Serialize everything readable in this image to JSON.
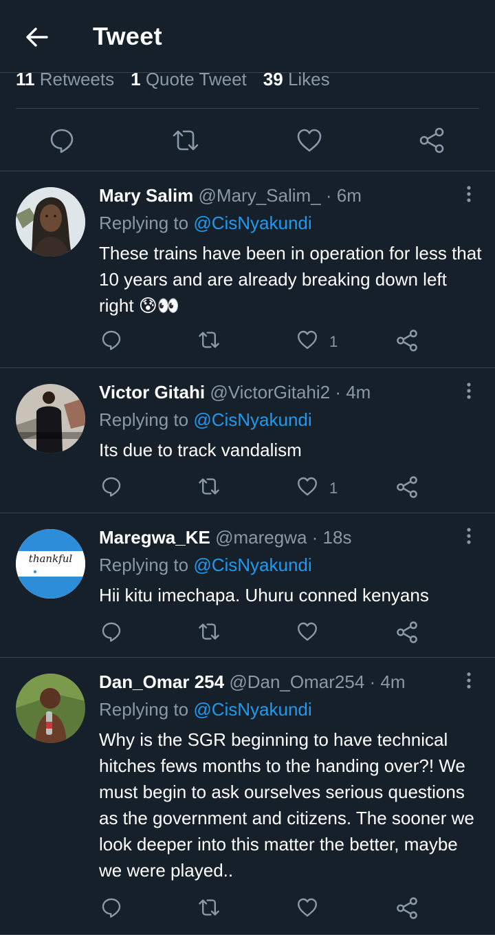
{
  "header": {
    "title": "Tweet"
  },
  "stats": {
    "retweets_count": "11",
    "retweets_label": "Retweets",
    "quotes_count": "1",
    "quotes_label": "Quote Tweet",
    "likes_count": "39",
    "likes_label": "Likes"
  },
  "replies": [
    {
      "name": "Mary Salim",
      "handle": "@Mary_Salim_",
      "time": "· 6m",
      "replying_prefix": "Replying to",
      "mention": "@CisNyakundi",
      "text": "These trains have been in operation for less that 10 years and are already breaking down left right 😰👀",
      "likes": "1"
    },
    {
      "name": "Victor Gitahi",
      "handle": "@VictorGitahi2",
      "time": "· 4m",
      "replying_prefix": "Replying to",
      "mention": "@CisNyakundi",
      "text": "Its due to track vandalism",
      "likes": "1"
    },
    {
      "name": "Maregwa_KE",
      "handle": "@maregwa",
      "time": "· 18s",
      "replying_prefix": "Replying to",
      "mention": "@CisNyakundi",
      "text": "Hii kitu imechapa. Uhuru conned kenyans",
      "likes": "",
      "avatar_text": "thankful"
    },
    {
      "name": "Dan_Omar 254",
      "handle": "@Dan_Omar254",
      "time": "· 4m",
      "replying_prefix": "Replying to",
      "mention": "@CisNyakundi",
      "text": "Why is the SGR beginning to have technical hitches fews months to the handing over?! We must begin to ask ourselves serious questions as the government and citizens. The sooner we look deeper into this matter the better, maybe we were played..",
      "likes": ""
    }
  ],
  "icons": {
    "back": "arrow-left-icon",
    "reply": "speech-bubble-icon",
    "retweet": "retweet-arrows-icon",
    "like": "heart-icon",
    "share": "share-nodes-icon",
    "more": "vertical-dots-icon"
  },
  "colors": {
    "background": "#15202b",
    "secondary_text": "#8b98a5",
    "accent": "#1d9bf0",
    "divider": "#38444d"
  }
}
